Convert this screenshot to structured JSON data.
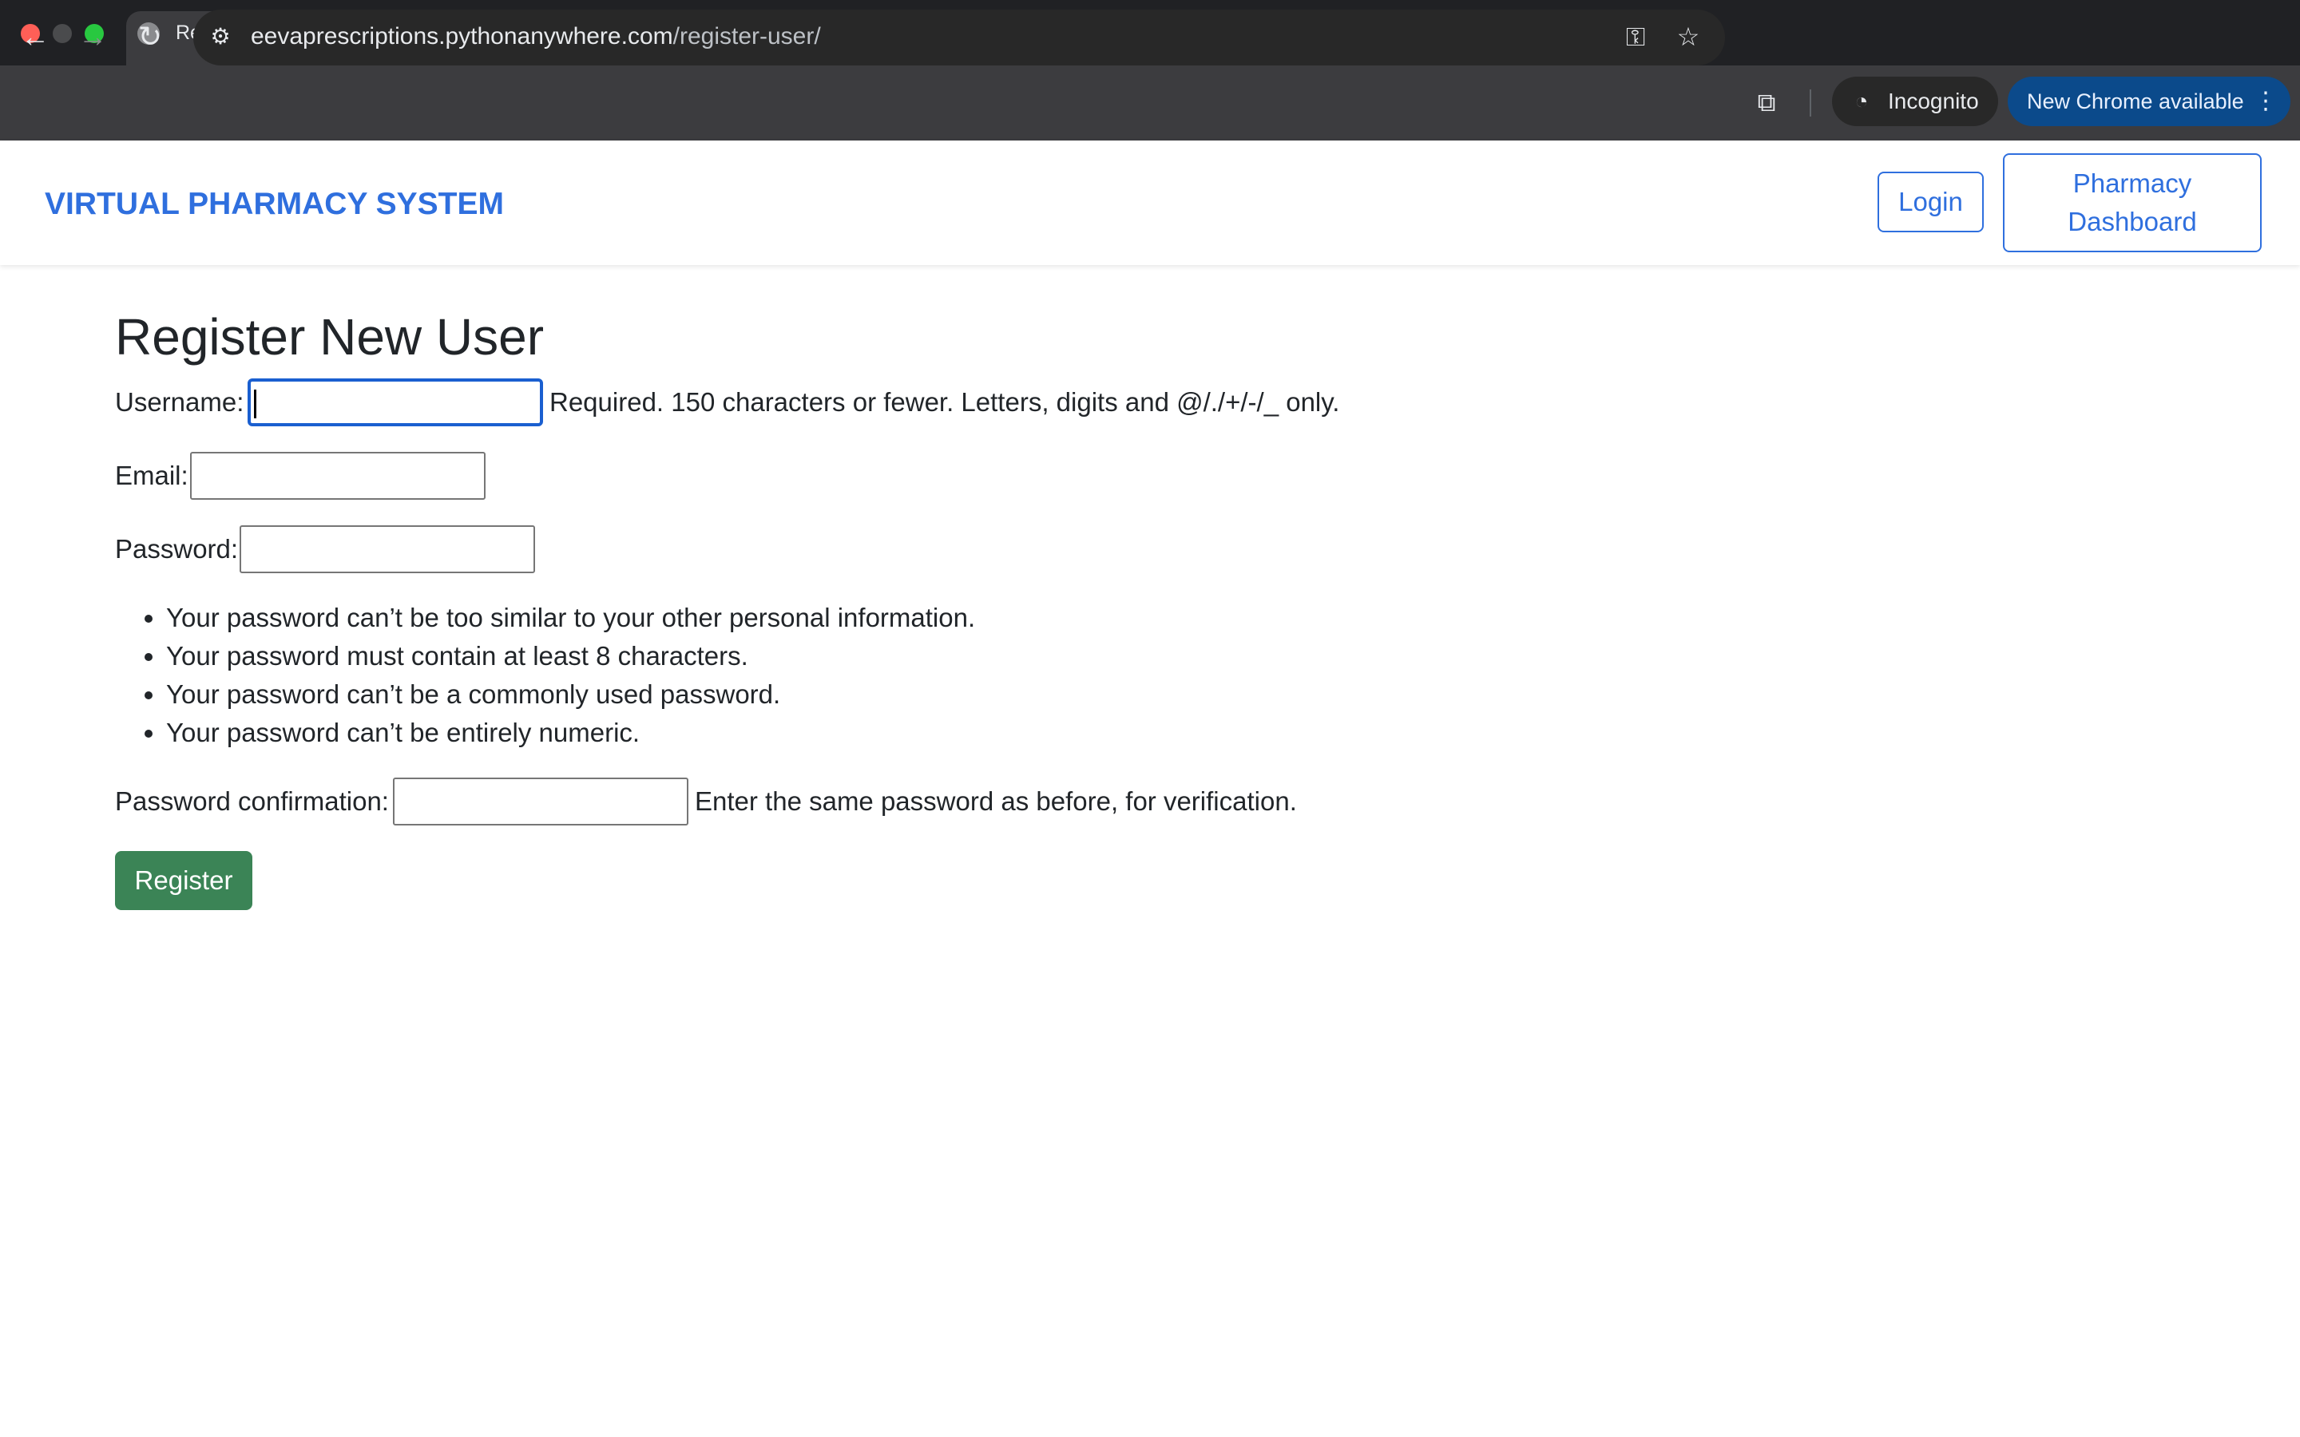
{
  "browser": {
    "tab_title": "Register",
    "close_glyph": "✕",
    "new_tab_glyph": "+",
    "url_host": "eevaprescriptions.pythonanywhere.com",
    "url_path": "/register-user/",
    "incognito_label": "Incognito",
    "update_label": "New Chrome available",
    "icons": {
      "back": "←",
      "forward": "→",
      "reload": "↻",
      "site_info": "⚙",
      "key": "⚿",
      "star": "☆",
      "cast": "⧉",
      "incognito": "◔",
      "menu": "⋮"
    }
  },
  "navbar": {
    "brand": "VIRTUAL PHARMACY SYSTEM",
    "login_label": "Login",
    "dashboard_label": "Pharmacy Dashboard",
    "accent_color": "#2f6fde"
  },
  "form": {
    "title": "Register New User",
    "username_label": "Username:",
    "username_value": "",
    "username_help": "Required. 150 characters or fewer. Letters, digits and @/./+/-/_ only.",
    "email_label": "Email:",
    "email_value": "",
    "password_label": "Password:",
    "password_value": "",
    "password_rules": [
      "Your password can’t be too similar to your other personal information.",
      "Your password must contain at least 8 characters.",
      "Your password can’t be a commonly used password.",
      "Your password can’t be entirely numeric."
    ],
    "confirm_label": "Password confirmation:",
    "confirm_value": "",
    "confirm_help": "Enter the same password as before, for verification.",
    "submit_label": "Register",
    "submit_color": "#3b8456"
  }
}
